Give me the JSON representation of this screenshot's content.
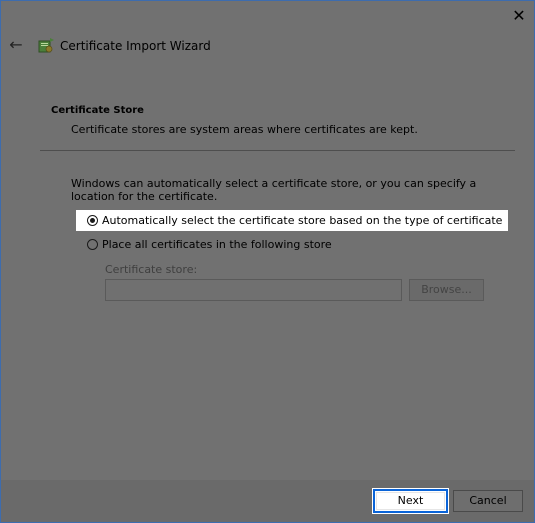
{
  "window": {
    "close_glyph": "✕",
    "back_glyph": "←",
    "title": "Certificate Import Wizard",
    "icon": "certificate-wizard-icon"
  },
  "section": {
    "heading": "Certificate Store",
    "description": "Certificate stores are system areas where certificates are kept."
  },
  "intro": "Windows can automatically select a certificate store, or you can specify a location for the certificate.",
  "options": {
    "auto_label": "Automatically select the certificate store based on the type of certificate",
    "auto_checked": true,
    "manual_label": "Place all certificates in the following store",
    "manual_checked": false
  },
  "store": {
    "label": "Certificate store:",
    "value": "",
    "browse_label": "Browse..."
  },
  "buttons": {
    "next": "Next",
    "cancel": "Cancel"
  },
  "colors": {
    "focus_border": "#0a64d8",
    "window_border": "#3d6cae"
  }
}
